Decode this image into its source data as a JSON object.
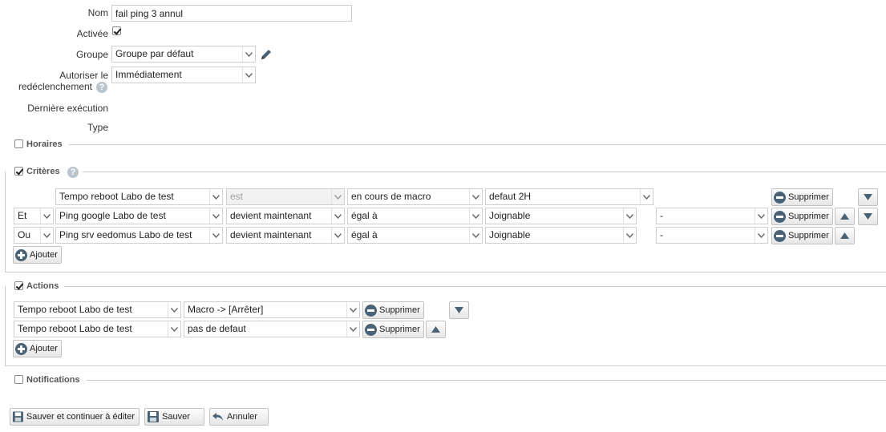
{
  "form": {
    "nom_label": "Nom",
    "nom_value": "fail ping 3 annul",
    "activee_label": "Activée",
    "groupe_label": "Groupe",
    "groupe_value": "Groupe par défaut",
    "autoriser_label_1": "Autoriser le",
    "autoriser_label_2": "redéclenchement",
    "autoriser_value": "Immédiatement",
    "derniere_label": "Dernière exécution",
    "type_label": "Type"
  },
  "sections": {
    "horaires": "Horaires",
    "criteres": "Critères",
    "actions": "Actions",
    "notifications": "Notifications"
  },
  "criteres": {
    "rows": [
      {
        "conj": "",
        "device": "Tempo reboot Labo de test",
        "op": "est",
        "cmp": "en cours de macro",
        "value": "defaut 2H",
        "extra": ""
      },
      {
        "conj": "Et",
        "device": "Ping google Labo de test",
        "op": "devient maintenant",
        "cmp": "égal à",
        "value": "Joignable",
        "extra": "-"
      },
      {
        "conj": "Ou",
        "device": "Ping srv eedomus Labo de test",
        "op": "devient maintenant",
        "cmp": "égal à",
        "value": "Joignable",
        "extra": "-"
      }
    ],
    "delete_label": "Supprimer",
    "add_label": "Ajouter"
  },
  "actions": {
    "rows": [
      {
        "device": "Tempo reboot Labo de test",
        "action": "Macro -> [Arrêter]"
      },
      {
        "device": "Tempo reboot Labo de test",
        "action": "pas de defaut"
      }
    ],
    "delete_label": "Supprimer",
    "add_label": "Ajouter"
  },
  "footer": {
    "save_continue": "Sauver et continuer à éditer",
    "save": "Sauver",
    "cancel": "Annuler"
  },
  "icons": {
    "help": "?"
  }
}
